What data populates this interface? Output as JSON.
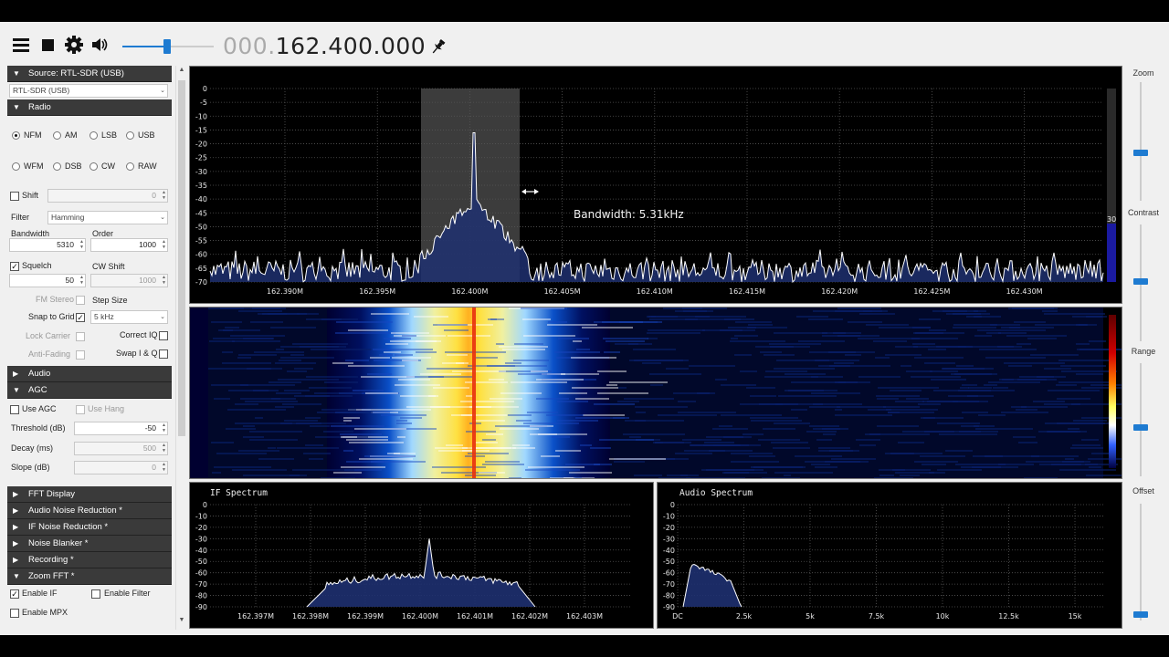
{
  "toolbar": {
    "frequency_prefix": "000.",
    "frequency_main": "162.400.000",
    "icons": [
      "menu-icon",
      "stop-icon",
      "gear-icon",
      "speaker-icon",
      "pin-icon"
    ],
    "volume_level": 0.5
  },
  "left_panel": {
    "source_header": "Source: RTL-SDR (USB)",
    "source_value": "RTL-SDR (USB)",
    "radio_header": "Radio",
    "modes": [
      "NFM",
      "AM",
      "LSB",
      "USB",
      "WFM",
      "DSB",
      "CW",
      "RAW"
    ],
    "selected_mode": "NFM",
    "shift_label": "Shift",
    "shift_value": "0",
    "filter_label": "Filter",
    "filter_value": "Hamming",
    "bandwidth_label": "Bandwidth",
    "bandwidth_value": "5310",
    "order_label": "Order",
    "order_value": "1000",
    "squelch_label": "Squelch",
    "squelch_value": "50",
    "cw_shift_label": "CW Shift",
    "cw_shift_value": "1000",
    "fm_stereo_label": "FM Stereo",
    "step_size_label": "Step Size",
    "snap_label": "Snap to Grid",
    "step_value": "5 kHz",
    "lock_carrier_label": "Lock Carrier",
    "correct_iq_label": "Correct IQ",
    "anti_fading_label": "Anti-Fading",
    "swap_iq_label": "Swap I & Q",
    "audio_header": "Audio",
    "agc_header": "AGC",
    "use_agc_label": "Use AGC",
    "use_hang_label": "Use Hang",
    "threshold_label": "Threshold (dB)",
    "threshold_value": "-50",
    "decay_label": "Decay (ms)",
    "decay_value": "500",
    "slope_label": "Slope (dB)",
    "slope_value": "0",
    "fft_header": "FFT Display",
    "anr_header": "Audio Noise Reduction *",
    "ifnr_header": "IF Noise Reduction *",
    "nb_header": "Noise Blanker *",
    "rec_header": "Recording *",
    "zoom_header": "Zoom FFT *",
    "enable_if_label": "Enable IF",
    "enable_filter_label": "Enable Filter",
    "enable_mpx_label": "Enable MPX"
  },
  "spectrum": {
    "bandwidth_text": "Bandwidth: 5.31kHz",
    "scale_value": "30",
    "y_ticks": [
      "0",
      "-5",
      "-10",
      "-15",
      "-20",
      "-25",
      "-30",
      "-35",
      "-40",
      "-45",
      "-50",
      "-55",
      "-60",
      "-65",
      "-70"
    ],
    "x_ticks": [
      "162.390M",
      "162.395M",
      "162.400M",
      "162.405M",
      "162.410M",
      "162.415M",
      "162.420M",
      "162.425M",
      "162.430M"
    ]
  },
  "if_spectrum": {
    "title": "IF Spectrum",
    "y_ticks": [
      "0",
      "-10",
      "-20",
      "-30",
      "-40",
      "-50",
      "-60",
      "-70",
      "-80",
      "-90"
    ],
    "x_ticks": [
      "162.397M",
      "162.398M",
      "162.399M",
      "162.400M",
      "162.401M",
      "162.402M",
      "162.403M"
    ]
  },
  "audio_spectrum": {
    "title": "Audio Spectrum",
    "y_ticks": [
      "0",
      "-10",
      "-20",
      "-30",
      "-40",
      "-50",
      "-60",
      "-70",
      "-80",
      "-90"
    ],
    "x_ticks": [
      "DC",
      "2.5k",
      "5k",
      "7.5k",
      "10k",
      "12.5k",
      "15k"
    ]
  },
  "right_sliders": {
    "zoom_label": "Zoom",
    "contrast_label": "Contrast",
    "range_label": "Range",
    "offset_label": "Offset"
  },
  "colors": {
    "accent": "#1e7bd1",
    "panel_bg": "#000000",
    "section_header": "#3a3a3a"
  }
}
